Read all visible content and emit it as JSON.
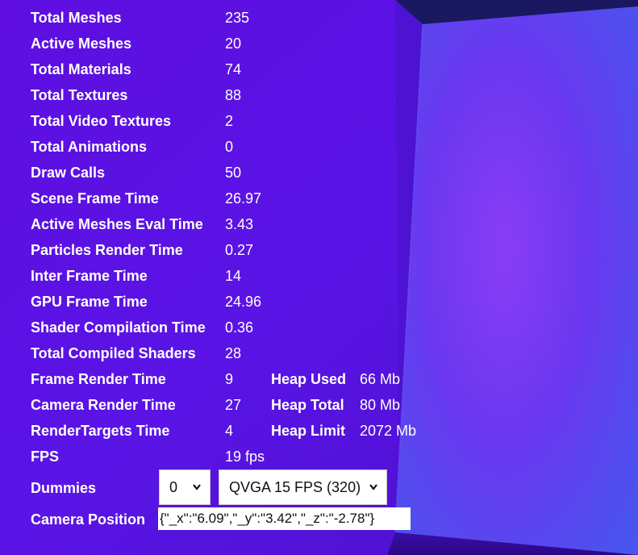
{
  "colors": {
    "background": "#5a10e0",
    "text": "#ffffff",
    "field_bg": "#ffffff",
    "field_text": "#111111"
  },
  "stats": [
    {
      "label": "Total Meshes",
      "value": "235"
    },
    {
      "label": "Active Meshes",
      "value": "20"
    },
    {
      "label": "Total Materials",
      "value": "74"
    },
    {
      "label": "Total Textures",
      "value": "88"
    },
    {
      "label": "Total Video Textures",
      "value": "2"
    },
    {
      "label": "Total Animations",
      "value": "0"
    },
    {
      "label": "Draw Calls",
      "value": "50"
    },
    {
      "label": "Scene Frame Time",
      "value": "26.97"
    },
    {
      "label": "Active Meshes Eval Time",
      "value": "3.43"
    },
    {
      "label": "Particles Render Time",
      "value": "0.27"
    },
    {
      "label": "Inter Frame Time",
      "value": "14"
    },
    {
      "label": "GPU Frame Time",
      "value": "24.96"
    },
    {
      "label": "Shader Compilation Time",
      "value": "0.36"
    },
    {
      "label": "Total Compiled Shaders",
      "value": "28"
    },
    {
      "label": "Frame Render Time",
      "value": "9"
    },
    {
      "label": "Camera Render Time",
      "value": "27"
    },
    {
      "label": "RenderTargets Time",
      "value": "4"
    },
    {
      "label": "FPS",
      "value": "19 fps"
    }
  ],
  "heap": [
    {
      "label": "Heap Used",
      "value": "66 Mb"
    },
    {
      "label": "Heap Total",
      "value": "80 Mb"
    },
    {
      "label": "Heap Limit",
      "value": "2072 Mb"
    }
  ],
  "dummies": {
    "label": "Dummies",
    "count_selected": "0",
    "quality_selected": "QVGA 15 FPS (320)"
  },
  "camera_position": {
    "label": "Camera Position",
    "value": "{\"_x\":\"6.09\",\"_y\":\"3.42\",\"_z\":\"-2.78\"}"
  },
  "icons": {
    "dropdown": "chevron-down-icon"
  }
}
